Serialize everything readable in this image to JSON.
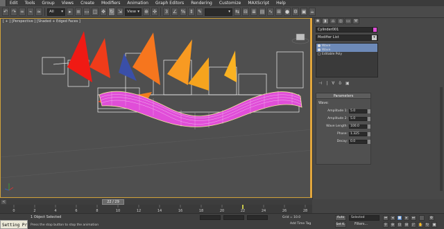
{
  "menu": [
    "Edit",
    "Tools",
    "Group",
    "Views",
    "Create",
    "Modifiers",
    "Animation",
    "Graph Editors",
    "Rendering",
    "Customize",
    "MAXScript",
    "Help"
  ],
  "toolbar": {
    "selection_filter": "All",
    "ref_coord": "View"
  },
  "viewport": {
    "label": "[ + ] [Perspective ] [Shaded + Edged Faces ]",
    "colors": {
      "border": "#d1a23a",
      "tube": "#e04ed8",
      "wireframe": "#ffffff"
    }
  },
  "command_panel": {
    "object_name": "Cylinder001",
    "object_color": "#e04ed8",
    "modifier_list_label": "Modifier List",
    "stack": [
      {
        "label": "Wave",
        "selected": true
      },
      {
        "label": "Wave",
        "selected": true
      },
      {
        "label": "Editable Poly",
        "selected": false
      }
    ],
    "parameters": {
      "rollout_title": "Parameters",
      "group_label": "Wave:",
      "rows": [
        {
          "label": "Amplitude 1:",
          "value": "5.0"
        },
        {
          "label": "Amplitude 2:",
          "value": "5.0"
        },
        {
          "label": "Wave Length:",
          "value": "100.0"
        },
        {
          "label": "Phase:",
          "value": "1.325"
        },
        {
          "label": "Decay:",
          "value": "0.0"
        }
      ]
    }
  },
  "timeline": {
    "frame_display": "22 / 29",
    "ticks": [
      "0",
      "2",
      "4",
      "6",
      "8",
      "10",
      "12",
      "14",
      "16",
      "18",
      "20",
      "22",
      "24",
      "26",
      "28"
    ]
  },
  "status": {
    "script_listener": "Setting Pr",
    "selection_status": "1 Object Selected",
    "prompt": "Press the stop button to stop the animation",
    "grid": "Grid = 10.0",
    "add_time_tag": "Add Time Tag",
    "auto_key": "Auto",
    "set_key": "Set K.",
    "key_mode": "Selected",
    "key_filters": "Filters..."
  }
}
